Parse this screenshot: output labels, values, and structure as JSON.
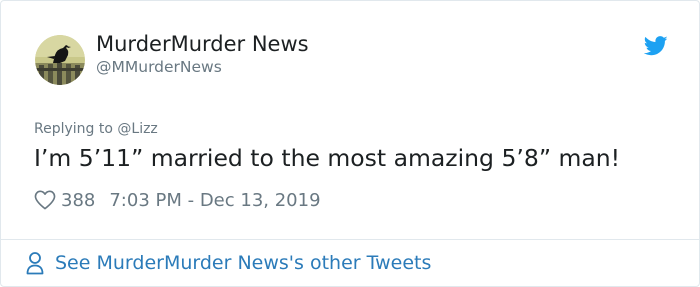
{
  "author": {
    "display_name": "MurderMurder News",
    "screen_name": "@MMurderNews",
    "avatar_icon": "crow-on-fence-avatar"
  },
  "brand": {
    "icon": "twitter-bird-icon",
    "color": "#1da1f2"
  },
  "reply": {
    "prefix": "Replying to ",
    "mention": "@Lizz"
  },
  "tweet": {
    "text": "I’m 5’11” married to the most amazing 5’8” man!",
    "like_icon": "heart-outline-icon",
    "like_count": "388",
    "timestamp": "7:03 PM - Dec 13, 2019"
  },
  "footer": {
    "icon": "person-outline-icon",
    "link_text": "See MurderMurder News's other Tweets",
    "link_color": "#2b7bb9"
  },
  "colors": {
    "text_primary": "#1c2022",
    "text_secondary": "#697882",
    "border": "#e1e8ed"
  }
}
